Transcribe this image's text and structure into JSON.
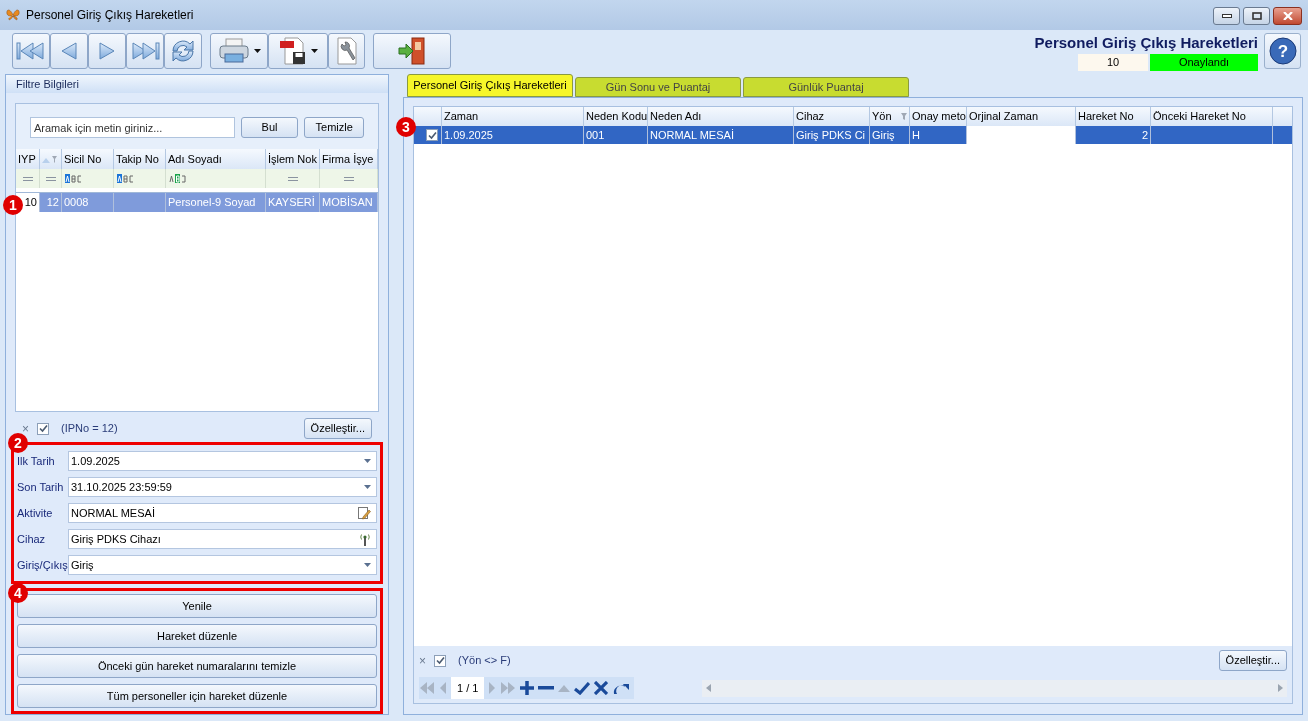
{
  "window": {
    "title": "Personel Giriş Çıkış Hareketleri"
  },
  "header": {
    "title": "Personel Giriş Çıkış Hareketleri",
    "code": "10",
    "status": "Onaylandı",
    "help": "?"
  },
  "filter_panel": {
    "title": "Filtre Bilgileri",
    "search": {
      "placeholder": "Aramak için metin giriniz..."
    },
    "buttons": [
      "Bul",
      "Temizle"
    ],
    "grid": {
      "columns": [
        {
          "label": "IYP",
          "kind": "text"
        },
        {
          "kind": "sort"
        },
        {
          "label": "Sicil No",
          "kind": "text"
        },
        {
          "label": "Takip No",
          "kind": "text"
        },
        {
          "label": "Adı Soyadı",
          "kind": "text"
        },
        {
          "label": "İşlem Nok",
          "kind": "text"
        },
        {
          "label": "Firma İşye",
          "kind": "text"
        }
      ],
      "filter_row": [
        {
          "kind": "equals"
        },
        {
          "kind": "equals"
        },
        {
          "kind": "begins"
        },
        {
          "kind": "begins"
        },
        {
          "kind": "contains"
        },
        {
          "kind": "equals"
        },
        {
          "kind": "equals"
        }
      ],
      "rows": [
        {
          "selected": true,
          "cells": [
            "10",
            "12",
            "0008",
            null,
            "Personel-9 Soyad",
            "KAYSERİ",
            "MOBİSAN"
          ]
        }
      ]
    },
    "filter_bar": {
      "close": "×",
      "enabled": true,
      "expression": "(IPNo = 12)",
      "customize": "Özelleştir..."
    },
    "fields": [
      {
        "label": "Ilk Tarih",
        "value": "1.09.2025",
        "kind": "dropdown"
      },
      {
        "label": "Son Tarih",
        "value": "31.10.2025 23:59:59",
        "kind": "dropdown"
      },
      {
        "label": "Aktivite",
        "value": "NORMAL MESAİ",
        "kind": "edit"
      },
      {
        "label": "Cihaz",
        "value": "Giriş PDKS Cihazı",
        "kind": "device"
      },
      {
        "label": "Giriş/Çıkış",
        "value": "Giriş",
        "kind": "dropdown"
      }
    ],
    "actions": [
      "Yenile",
      "Hareket düzenle",
      "Önceki gün hareket numaralarını temizle",
      "Tüm personeller için hareket düzenle"
    ]
  },
  "tabs": [
    {
      "label": "Personel Giriş Çıkış Hareketleri",
      "selected": true
    },
    {
      "label": "Gün Sonu ve Puantaj",
      "selected": false
    },
    {
      "label": "Günlük Puantaj",
      "selected": false
    }
  ],
  "movements_grid": {
    "columns": [
      {
        "label": "Zaman"
      },
      {
        "label": "Neden Kodu"
      },
      {
        "label": "Neden Adı"
      },
      {
        "label": "Cihaz"
      },
      {
        "label": "Yön",
        "kind": "text",
        "filtered": true
      },
      {
        "label": "Onay meto"
      },
      {
        "label": "Orjinal Zaman"
      },
      {
        "label": "Hareket No",
        "kind": "number"
      },
      {
        "label": "Önceki Hareket No"
      }
    ],
    "rows": [
      {
        "selected": true,
        "checked": true,
        "cells": [
          "1.09.2025",
          "001",
          "NORMAL MESAİ",
          "Giriş PDKS Ci",
          "Giriş",
          "H",
          null,
          "2",
          null
        ]
      }
    ]
  },
  "movements_filter_bar": {
    "close": "×",
    "enabled": true,
    "expression": "(Yön <> F)",
    "customize": "Özelleştir..."
  },
  "navigator": {
    "page": "1 / 1"
  },
  "annotations": [
    {
      "label": "1"
    },
    {
      "label": "2"
    },
    {
      "label": "3"
    },
    {
      "label": "4"
    }
  ]
}
